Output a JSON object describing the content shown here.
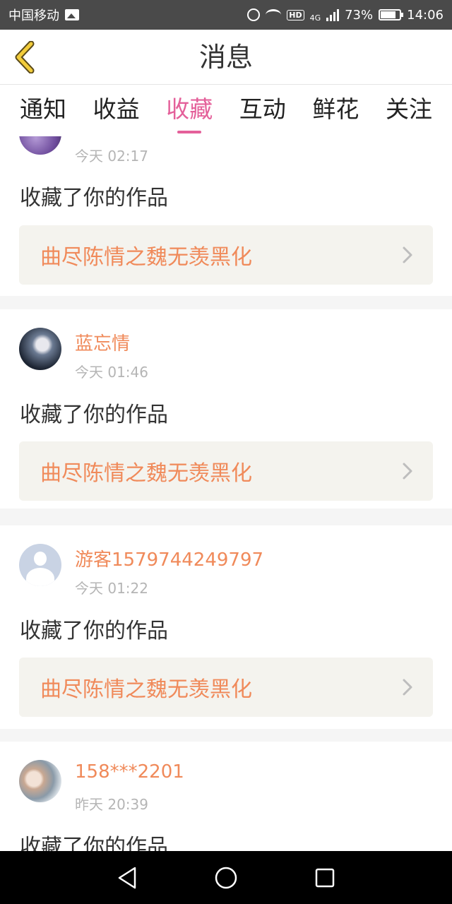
{
  "status_bar": {
    "carrier": "中国移动",
    "network": "4G",
    "hd": "HD",
    "battery": "73%",
    "time": "14:06"
  },
  "nav": {
    "title": "消息"
  },
  "tabs": [
    {
      "label": "通知",
      "active": false
    },
    {
      "label": "收益",
      "active": false
    },
    {
      "label": "收藏",
      "active": true
    },
    {
      "label": "互动",
      "active": false
    },
    {
      "label": "鲜花",
      "active": false
    },
    {
      "label": "关注",
      "active": false
    }
  ],
  "colors": {
    "accent_pink": "#e4609a",
    "username_orange": "#f08a5a",
    "work_box_bg": "#f4f3ee"
  },
  "messages": [
    {
      "username": "",
      "time": "今天 02:17",
      "action": "收藏了你的作品",
      "work_title": "曲尽陈情之魏无羡黑化",
      "avatar": "purple-avatar"
    },
    {
      "username": "蓝忘情",
      "time": "今天 01:46",
      "action": "收藏了你的作品",
      "work_title": "曲尽陈情之魏无羡黑化",
      "avatar": "character-avatar"
    },
    {
      "username": "游客1579744249797",
      "time": "今天 01:22",
      "action": "收藏了你的作品",
      "work_title": "曲尽陈情之魏无羡黑化",
      "avatar": "default-guest-avatar"
    },
    {
      "username": "158***2201",
      "time": "昨天 20:39",
      "action": "收藏了你的作品",
      "work_title": "",
      "avatar": "photo-avatar"
    }
  ]
}
